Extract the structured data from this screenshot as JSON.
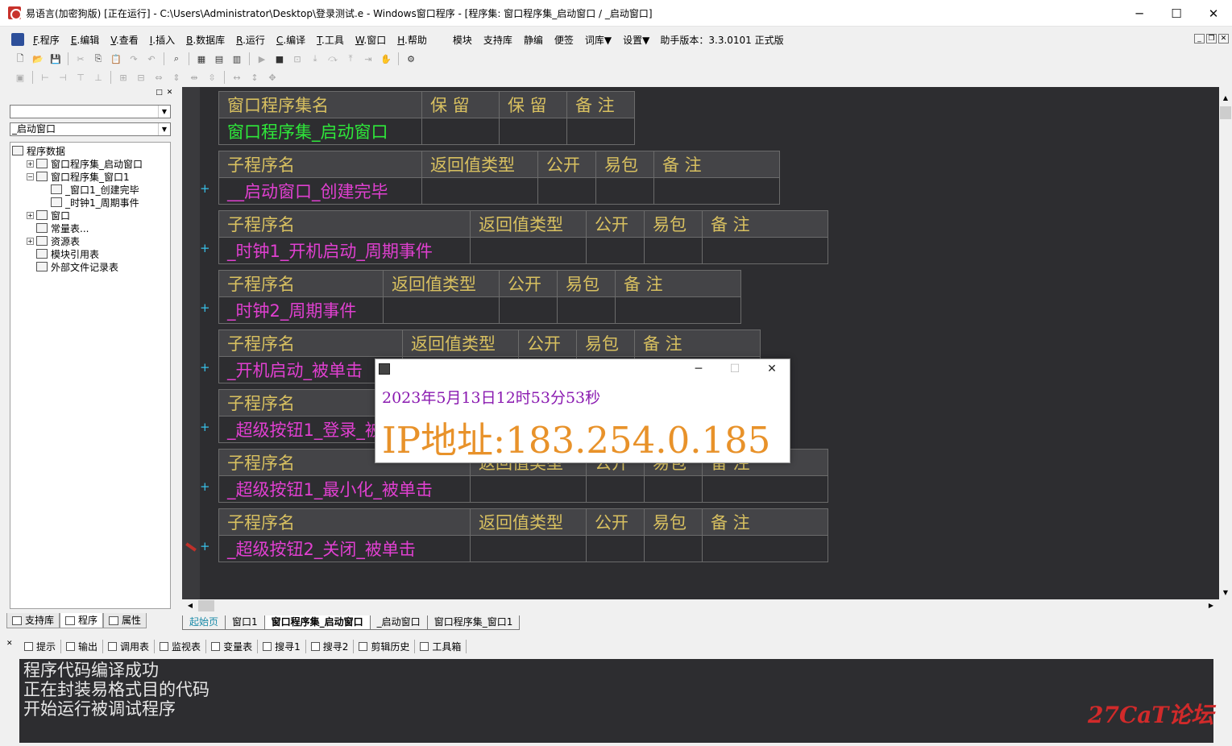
{
  "window": {
    "title": "易语言(加密狗版) [正在运行] - C:\\Users\\Administrator\\Desktop\\登录测试.e - Windows窗口程序 - [程序集: 窗口程序集_启动窗口 / _启动窗口]",
    "minimize": "─",
    "maximize": "☐",
    "close": "✕"
  },
  "menu": {
    "items": [
      {
        "key": "F",
        "label": ".程序"
      },
      {
        "key": "E",
        "label": ".编辑"
      },
      {
        "key": "V",
        "label": ".查看"
      },
      {
        "key": "I",
        "label": ".插入"
      },
      {
        "key": "B",
        "label": ".数据库"
      },
      {
        "key": "R",
        "label": ".运行"
      },
      {
        "key": "C",
        "label": ".编译"
      },
      {
        "key": "T",
        "label": ".工具"
      },
      {
        "key": "W",
        "label": ".窗口"
      },
      {
        "key": "H",
        "label": ".帮助"
      }
    ],
    "extra": [
      "模块",
      "支持库",
      "静编",
      "便签",
      "词库▼",
      "设置▼"
    ],
    "helper_version": "助手版本：3.3.0101 正式版"
  },
  "left_panel": {
    "combo1": "",
    "combo2": "_启动窗口",
    "tree": [
      {
        "label": "程序数据",
        "level": 0,
        "exp": ""
      },
      {
        "label": "窗口程序集_启动窗口",
        "level": 1,
        "exp": "+"
      },
      {
        "label": "窗口程序集_窗口1",
        "level": 1,
        "exp": "−"
      },
      {
        "label": "_窗口1_创建完毕",
        "level": 2,
        "exp": ""
      },
      {
        "label": "_时钟1_周期事件",
        "level": 2,
        "exp": ""
      },
      {
        "label": "窗口",
        "level": 1,
        "exp": "+"
      },
      {
        "label": "常量表...",
        "level": 1,
        "exp": ""
      },
      {
        "label": "资源表",
        "level": 1,
        "exp": "+"
      },
      {
        "label": "模块引用表",
        "level": 1,
        "exp": ""
      },
      {
        "label": "外部文件记录表",
        "level": 1,
        "exp": ""
      }
    ],
    "tabs": [
      "支持库",
      "程序",
      "属性"
    ]
  },
  "editor": {
    "assembly_table": {
      "headers": [
        "窗口程序集名",
        "保  留",
        "保  留",
        "备  注"
      ],
      "row": [
        "窗口程序集_启动窗口",
        "",
        "",
        ""
      ]
    },
    "sub_headers": [
      "子程序名",
      "返回值类型",
      "公开",
      "易包",
      "备  注"
    ],
    "subs": [
      "__启动窗口_创建完毕",
      "_时钟1_开机启动_周期事件",
      "_时钟2_周期事件",
      "_开机启动_被单击",
      "_超级按钮1_登录_被单击",
      "_超级按钮1_最小化_被单击",
      "_超级按钮2_关闭_被单击"
    ],
    "plus": "+"
  },
  "doc_tabs": [
    "起始页",
    "窗口1",
    "窗口程序集_启动窗口",
    "_启动窗口",
    "窗口程序集_窗口1"
  ],
  "bottom_tabs": [
    "提示",
    "输出",
    "调用表",
    "监视表",
    "变量表",
    "搜寻1",
    "搜寻2",
    "剪辑历史",
    "工具箱"
  ],
  "output_lines": [
    "程序代码编译成功",
    "正在封装易格式目的代码",
    "开始运行被调试程序"
  ],
  "popup": {
    "datetime": "2023年5月13日12时53分53秒",
    "ip": "IP地址:183.254.0.185",
    "minimize": "─",
    "maximize": "☐",
    "close": "✕"
  },
  "watermark": "27CaT论坛",
  "colors": {
    "editor_bg": "#2d2d30",
    "header_text": "#d8c060",
    "assembly_name": "#2ee83a",
    "sub_name": "#e040d0",
    "popup_date": "#8a1ab0",
    "popup_ip": "#e8922a"
  }
}
